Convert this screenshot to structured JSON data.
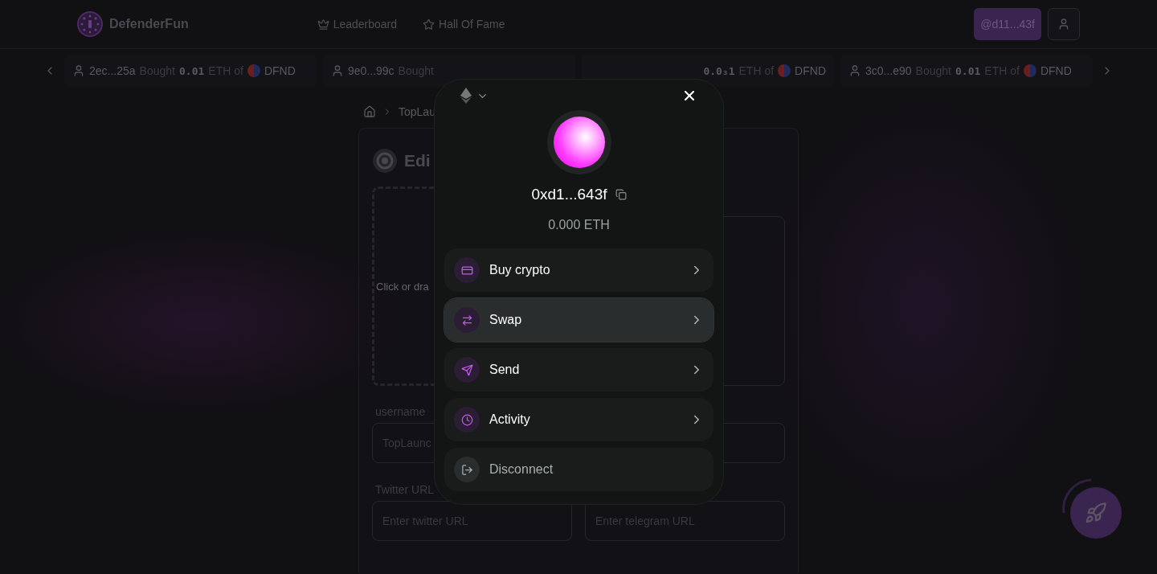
{
  "header": {
    "brand": "DefenderFun",
    "nav": [
      {
        "label": "Leaderboard"
      },
      {
        "label": "Hall Of Fame"
      }
    ],
    "account_button": "@d11...43f"
  },
  "ticker": [
    {
      "user": "2ec...25a",
      "action": "Bought",
      "amount": "0.01",
      "unit": "ETH of",
      "token": "DFND"
    },
    {
      "user": "9e0...99c",
      "action": "Bought"
    },
    {
      "amount": "0.0₃1",
      "unit": "ETH of",
      "token": "DFND"
    },
    {
      "user": "3c0...e90",
      "action": "Bought",
      "amount": "0.01",
      "unit": "ETH of",
      "token": "DFND"
    }
  ],
  "breadcrumb": {
    "current": "TopLau"
  },
  "form": {
    "title": "Edi",
    "upload_hint": "Click or dra",
    "username_label": "username",
    "username_value": "TopLaunc",
    "twitter_label": "Twitter URL",
    "twitter_placeholder": "Enter twitter URL",
    "telegram_placeholder": "Enter telegram URL"
  },
  "wallet_modal": {
    "address": "0xd1...643f",
    "balance": "0.000 ETH",
    "actions": [
      {
        "label": "Buy crypto",
        "kind": "action",
        "selected": false
      },
      {
        "label": "Swap",
        "kind": "action",
        "selected": true
      },
      {
        "label": "Send",
        "kind": "action",
        "selected": false
      },
      {
        "label": "Activity",
        "kind": "action",
        "selected": false
      },
      {
        "label": "Disconnect",
        "kind": "disconnect",
        "selected": false
      }
    ]
  }
}
